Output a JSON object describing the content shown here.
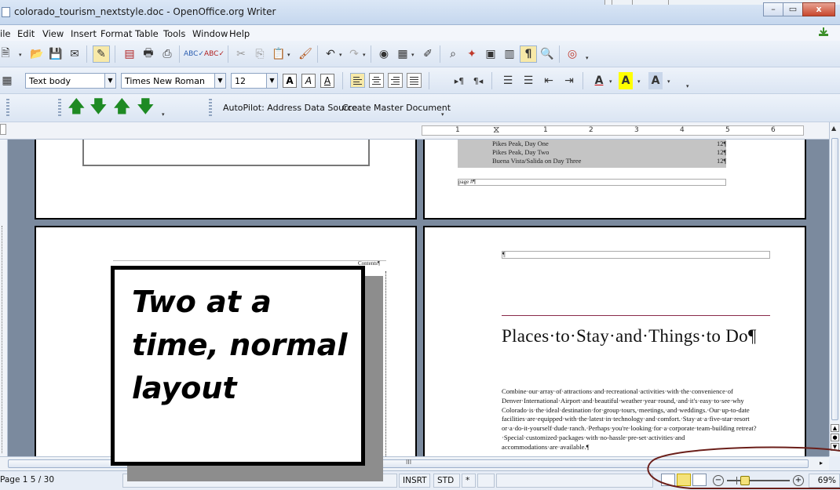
{
  "window": {
    "title": "colorado_tourism_nextstyle.doc - OpenOffice.org Writer",
    "buttons": {
      "minimize": "–",
      "maximize": "▭",
      "close": "x"
    }
  },
  "menu": {
    "items": [
      "ile",
      "Edit",
      "View",
      "Insert",
      "Format",
      "Table",
      "Tools",
      "Window",
      "Help"
    ]
  },
  "formatting": {
    "paragraph_style": "Text body",
    "font_name": "Times New Roman",
    "font_size": "12"
  },
  "toolbar3": {
    "autopilot_label": "AutoPilot: Address Data Source",
    "master_doc_label": "Create Master Document"
  },
  "ruler": {
    "numbers": [
      "1",
      "1",
      "2",
      "3",
      "4",
      "5",
      "6"
    ]
  },
  "page_left_bottom": {
    "contents_label": "Contents¶"
  },
  "page_right_top": {
    "toc": [
      {
        "text": "Pikes Peak, Day One",
        "page": "12¶"
      },
      {
        "text": "Pikes Peak, Day Two",
        "page": "12¶"
      },
      {
        "text": "Buena Vista/Salida on Day Three",
        "page": "12¶"
      }
    ],
    "page_marker": "page #¶"
  },
  "page_right_bottom": {
    "pilcrow": "¶",
    "heading": "Places·to·Stay·and·Things·to Do¶",
    "body": "Combine·our·array·of·attractions·and·recreational·activities·with·the·convenience·of Denver·International·Airport·and·beautiful·weather·year·round,·and·it's·easy·to·see·why Colorado·is·the·ideal·destination·for·group·tours,·meetings,·and·weddings.·Our·up-to-date facilities·are·equipped·with·the·latest·in·technology·and·comfort.·Stay·at·a·five-star·resort or·a·do-it-yourself·dude·ranch.·Perhaps·you're·looking·for·a·corporate·team-building retreat?·Special·customized·packages·with·no-hassle·pre-set·activities·and accommodations·are·available.¶"
  },
  "callout": {
    "text": "Two at a time, normal layout"
  },
  "statusbar": {
    "page": "Page 1  5 / 30",
    "insert_mode": "INSRT",
    "selection_mode": "STD",
    "modified": "*",
    "zoom": "69%",
    "zoom_fraction": 0.25
  },
  "hscroll_marker": "III",
  "colors": {
    "highlight": "#f4e27a",
    "annotation": "#6b1f1a",
    "arrow_green": "#1e8a23"
  }
}
